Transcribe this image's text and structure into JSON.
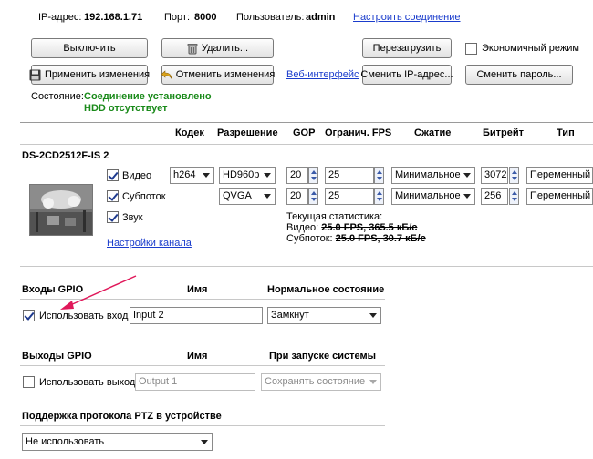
{
  "connection": {
    "ip_label": "IP-адрес:",
    "ip_value": "192.168.1.71",
    "port_label": "Порт:",
    "port_value": "8000",
    "user_label": "Пользователь:",
    "user_value": "admin",
    "setup_link": "Настроить соединение"
  },
  "toolbar": {
    "power_off": "Выключить",
    "delete": "Удалить...",
    "reboot": "Перезагрузить",
    "eco_mode": "Экономичный режим",
    "apply": "Применить изменения",
    "revert": "Отменить изменения",
    "web_link": "Веб-интерфейс",
    "change_ip": "Сменить IP-адрес...",
    "change_password": "Сменить пароль..."
  },
  "status": {
    "label": "Состояние:",
    "connection": "Соединение установлено",
    "hdd": "HDD отсутствует"
  },
  "streams": {
    "headers": {
      "codec": "Кодек",
      "resolution": "Разрешение",
      "gop": "GOP",
      "fps_limit": "Огранич. FPS",
      "compression": "Сжатие",
      "bitrate": "Битрейт",
      "type": "Тип"
    },
    "camera_name": "DS-2CD2512F-IS 2",
    "video": {
      "label": "Видео",
      "codec": "h264",
      "resolution": "HD960p",
      "gop": "20",
      "fps": "25",
      "compression": "Минимальное",
      "bitrate": "3072",
      "type": "Переменный"
    },
    "substream": {
      "label": "Субпоток",
      "resolution": "QVGA",
      "gop": "20",
      "fps": "25",
      "compression": "Минимальное",
      "bitrate": "256",
      "type": "Переменный"
    },
    "audio_label": "Звук",
    "channel_settings_link": "Настройки канала",
    "stats": {
      "title": "Текущая статистика:",
      "video_label": "Видео:",
      "video_value": "25.0 FPS, 365.5 кБ/с",
      "sub_label": "Субпоток:",
      "sub_value": "25.0 FPS, 30.7 кБ/с"
    }
  },
  "gpio_inputs": {
    "title": "Входы GPIO",
    "name_header": "Имя",
    "state_header": "Нормальное состояние",
    "use_label": "Использовать вход",
    "name_value": "Input 2",
    "state_value": "Замкнут"
  },
  "gpio_outputs": {
    "title": "Выходы GPIO",
    "name_header": "Имя",
    "startup_header": "При запуске системы",
    "use_label": "Использовать выход",
    "name_value": "Output 1",
    "startup_value": "Сохранять состояние"
  },
  "ptz": {
    "title": "Поддержка протокола PTZ в устройстве",
    "value": "Не использовать"
  },
  "colors": {
    "link": "#1a3ccc",
    "status_green": "#1a8a1a",
    "annotation_arrow": "#e0185a"
  }
}
